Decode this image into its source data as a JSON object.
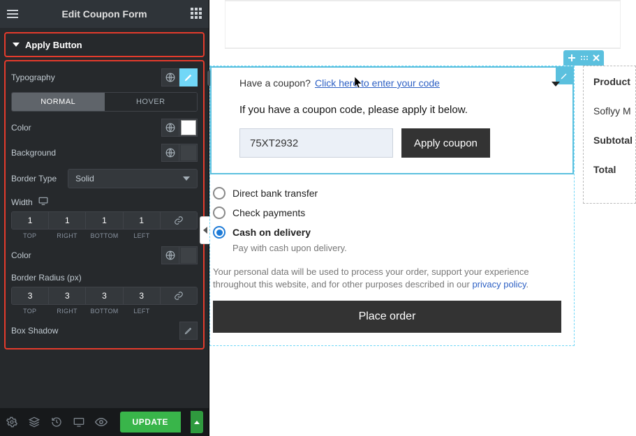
{
  "header": {
    "title": "Edit Coupon Form"
  },
  "section": {
    "title": "Apply Button"
  },
  "controls": {
    "typography_label": "Typography",
    "tab_normal": "NORMAL",
    "tab_hover": "HOVER",
    "color_label": "Color",
    "background_label": "Background",
    "border_type_label": "Border Type",
    "border_type_value": "Solid",
    "width_label": "Width",
    "width": {
      "top": "1",
      "right": "1",
      "bottom": "1",
      "left": "1"
    },
    "dim_labels": {
      "top": "TOP",
      "right": "RIGHT",
      "bottom": "BOTTOM",
      "left": "LEFT"
    },
    "border_radius_label": "Border Radius (px)",
    "radius": {
      "top": "3",
      "right": "3",
      "bottom": "3",
      "left": "3"
    },
    "box_shadow_label": "Box Shadow"
  },
  "footer": {
    "update": "UPDATE"
  },
  "preview": {
    "coupon_q": "Have a coupon?",
    "coupon_link": "Click here to enter your code",
    "apply_hint": "If you have a coupon code, please apply it below.",
    "code_value": "75XT2932",
    "apply_btn": "Apply coupon",
    "payments": {
      "bank": "Direct bank transfer",
      "check": "Check payments",
      "cod": "Cash on delivery",
      "cod_desc": "Pay with cash upon delivery."
    },
    "privacy_a": "Your personal data will be used to process your order, support your experience throughout this website, and for other purposes described in our ",
    "privacy_link": "privacy policy",
    "place_order": "Place order",
    "summary": {
      "product": "Product",
      "item": "Soflyy M",
      "subtotal": "Subtotal",
      "total": "Total"
    }
  }
}
